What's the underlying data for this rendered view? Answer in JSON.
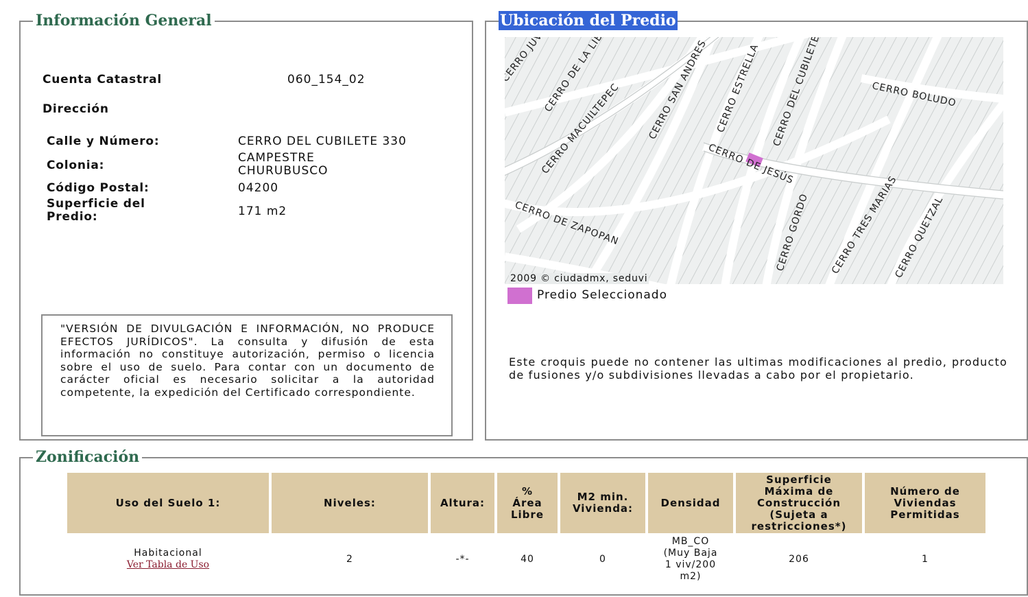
{
  "info": {
    "legend": "Información General",
    "cuenta_label": "Cuenta Catastral",
    "cuenta_value": "060_154_02",
    "direccion_label": "Dirección",
    "calle_label": "Calle y Número:",
    "calle_value": "CERRO DEL CUBILETE 330",
    "colonia_label": "Colonia:",
    "colonia_line1": "CAMPESTRE",
    "colonia_line2": "CHURUBUSCO",
    "cp_label": "Código Postal:",
    "cp_value": "04200",
    "superficie_label_line1": "Superficie del",
    "superficie_label_line2": "Predio:",
    "superficie_value": "171 m2",
    "disclaimer": "\"VERSIÓN DE DIVULGACIÓN E INFORMACIÓN, NO PRODUCE EFECTOS JURÍDICOS\". La consulta y difusión de esta información no constituye autorización, permiso o licencia sobre el uso de suelo. Para contar con un documento de carácter oficial es necesario solicitar a la autoridad competente, la expedición del Certificado correspondiente."
  },
  "map": {
    "legend": "Ubicación del Predio",
    "copyright": "2009 © ciudadmx, seduvi",
    "selected_label": "Predio Seleccionado",
    "note": "Este croquis puede no contener las ultimas modificaciones al predio, producto de fusiones y/o subdivisiones llevadas a cabo por el propietario.",
    "streets": {
      "s1": "CERRO JUVENCIO",
      "s2": "CERRO DE LA LIBERTAD",
      "s3": "CERRO MACUILTEPEC",
      "s4": "CERRO SAN ANDRES",
      "s5": "CERRO ESTRELLA",
      "s6": "CERRO DEL CUBILETE",
      "s7": "CERRO BOLUDO",
      "s8": "CERRO DE JESÚS",
      "s9": "CERRO DE ZAPOPAN",
      "s10": "CERRO GORDO",
      "s11": "CERRO TRES MARIAS",
      "s12": "CERRO QUETZAL"
    },
    "colors": {
      "background": "#e9ecec",
      "block": "#c3c7c7",
      "selected": "#d070d0"
    }
  },
  "zon": {
    "legend": "Zonificación",
    "headers": {
      "uso": "Uso del Suelo 1:",
      "niveles": "Niveles:",
      "altura": "Altura:",
      "libre_1": "%",
      "libre_2": "Área",
      "libre_3": "Libre",
      "m2_1": "M2 min.",
      "m2_2": "Vivienda:",
      "densidad": "Densidad",
      "sup_1": "Superficie",
      "sup_2": "Máxima de",
      "sup_3": "Construcción",
      "sup_4": "(Sujeta a",
      "sup_5": "restricciones*)",
      "num_1": "Número de",
      "num_2": "Viviendas",
      "num_3": "Permitidas"
    },
    "row": {
      "uso": "Habitacional",
      "uso_link": "Ver Tabla de Uso",
      "niveles": "2",
      "altura": "-*-",
      "libre": "40",
      "m2": "0",
      "densidad_1": "MB_CO",
      "densidad_2": "(Muy Baja",
      "densidad_3": "1 viv/200",
      "densidad_4": "m2)",
      "superficie": "206",
      "viviendas": "1"
    }
  }
}
